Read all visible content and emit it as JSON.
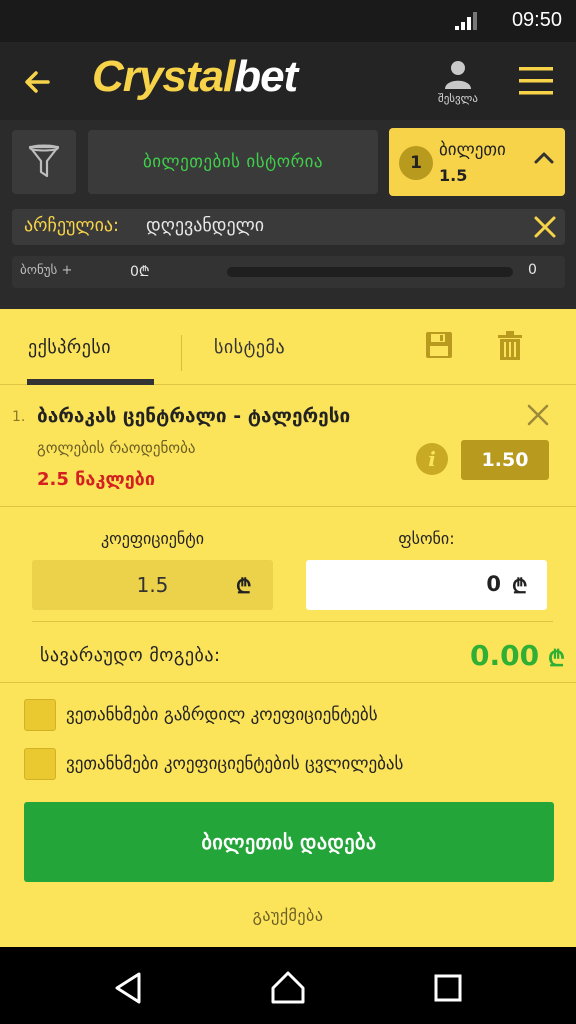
{
  "status_bar": {
    "time": "09:50"
  },
  "header": {
    "logo_part1": "Crystal",
    "logo_part2": "bet",
    "account_label": "შესვლა",
    "colors": {
      "brand_yellow": "#f7d34a",
      "green": "#3fd04a"
    }
  },
  "filter_row": {
    "history_label": "ბილეთების ისტორია",
    "ticket_count": "1",
    "ticket_label": "ბილეთი",
    "ticket_odds": "1.5"
  },
  "selected": {
    "label": "არჩეულია:",
    "value": "დღევანდელი"
  },
  "bonus": {
    "label": "ბონუს +",
    "amount": "0₾",
    "max": "0",
    "progress": 0
  },
  "slip": {
    "tabs": [
      {
        "label": "ექსპრესი",
        "active": true
      },
      {
        "label": "სისტემა",
        "active": false
      }
    ],
    "event": {
      "number": "1.",
      "title": "ბარაკას ცენტრალი - ტალერესი",
      "market": "გოლების რაოდენობა",
      "pick": "2.5 ნაკლები",
      "odds": "1.50"
    },
    "coef_label": "კოეფიციენტი",
    "stake_label": "ფსონი:",
    "coef_value": "1.5",
    "stake_value": "0",
    "currency": "₾",
    "win_label": "სავარაუდო მოგება:",
    "win_value": "0.00",
    "checkboxes": [
      {
        "label": "ვეთანხმები გაზრდილ კოეფიციენტებს",
        "checked": false
      },
      {
        "label": "ვეთანხმები კოეფიციენტების ცვლილებას",
        "checked": false
      }
    ],
    "place_label": "ბილეთის დადება",
    "cancel_label": "გაუქმება"
  }
}
